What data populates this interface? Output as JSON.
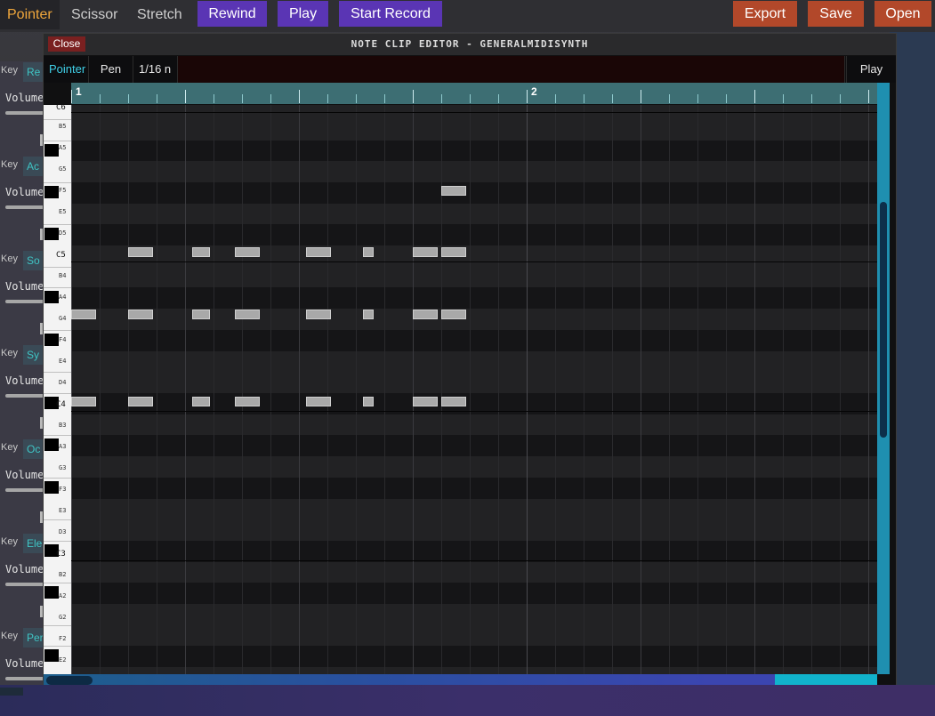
{
  "toolbar": {
    "tools": [
      "Pointer",
      "Scissor",
      "Stretch"
    ],
    "rewind": "Rewind",
    "play": "Play",
    "start_record": "Start Record",
    "export": "Export",
    "save": "Save",
    "open": "Open"
  },
  "tracks": [
    {
      "key": "Key",
      "name": "Re",
      "volume": "Volume"
    },
    {
      "key": "Key",
      "name": "Ac",
      "volume": "Volume"
    },
    {
      "key": "Key",
      "name": "So",
      "volume": "Volume"
    },
    {
      "key": "Key",
      "name": "Sy",
      "volume": "Volume"
    },
    {
      "key": "Key",
      "name": "Oc",
      "volume": "Volume"
    },
    {
      "key": "Key",
      "name": "Ele",
      "volume": "Volume"
    },
    {
      "key": "Key",
      "name": "Per",
      "volume": "Volume"
    }
  ],
  "editor": {
    "close": "Close",
    "title": "NOTE CLIP EDITOR - GENERALMIDISYNTH",
    "tools": {
      "pointer": "Pointer",
      "pen": "Pen",
      "quantize": "1/16 n",
      "play": "Play"
    },
    "bars": [
      "1",
      "2"
    ],
    "pitch_labels": [
      "C6",
      "B5",
      "A5",
      "G5",
      "F5",
      "E5",
      "D5",
      "C5",
      "B4",
      "A4",
      "G4",
      "F4",
      "E4",
      "D4",
      "C4",
      "B3",
      "A3",
      "G3",
      "F3",
      "E3",
      "D3",
      "C3",
      "B2",
      "A2",
      "G2",
      "F2",
      "E2"
    ]
  },
  "colors": {
    "accent_active": "#f0a73c",
    "purple_button": "#5a35b4",
    "red_button": "#b2482a",
    "ruler": "#3d6e73",
    "note": "#a9a9a9"
  },
  "notes": [
    {
      "pitch": "D4",
      "start": 0.0,
      "length": 0.25
    },
    {
      "pitch": "G3",
      "start": 0.0,
      "length": 0.25
    },
    {
      "pitch": "G4",
      "start": 0.5,
      "length": 0.25
    },
    {
      "pitch": "D4",
      "start": 0.5,
      "length": 0.25
    },
    {
      "pitch": "G3",
      "start": 0.5,
      "length": 0.25
    },
    {
      "pitch": "G4",
      "start": 1.0625,
      "length": 0.1875
    },
    {
      "pitch": "D4",
      "start": 1.0625,
      "length": 0.1875
    },
    {
      "pitch": "G3",
      "start": 1.0625,
      "length": 0.1875
    },
    {
      "pitch": "G4",
      "start": 1.4375,
      "length": 0.25
    },
    {
      "pitch": "D4",
      "start": 1.4375,
      "length": 0.25
    },
    {
      "pitch": "G3",
      "start": 1.4375,
      "length": 0.25
    },
    {
      "pitch": "G4",
      "start": 2.0625,
      "length": 0.25
    },
    {
      "pitch": "D4",
      "start": 2.0625,
      "length": 0.25
    },
    {
      "pitch": "G3",
      "start": 2.0625,
      "length": 0.25
    },
    {
      "pitch": "G4",
      "start": 2.5625,
      "length": 0.125
    },
    {
      "pitch": "D4",
      "start": 2.5625,
      "length": 0.125
    },
    {
      "pitch": "G3",
      "start": 2.5625,
      "length": 0.125
    },
    {
      "pitch": "G4",
      "start": 3.0,
      "length": 0.25
    },
    {
      "pitch": "D4",
      "start": 3.0,
      "length": 0.25
    },
    {
      "pitch": "G3",
      "start": 3.0,
      "length": 0.25
    },
    {
      "pitch": "G4",
      "start": 3.25,
      "length": 0.25
    },
    {
      "pitch": "D4",
      "start": 3.25,
      "length": 0.25
    },
    {
      "pitch": "G3",
      "start": 3.25,
      "length": 0.25
    },
    {
      "pitch": "C5",
      "start": 3.25,
      "length": 0.25
    }
  ]
}
